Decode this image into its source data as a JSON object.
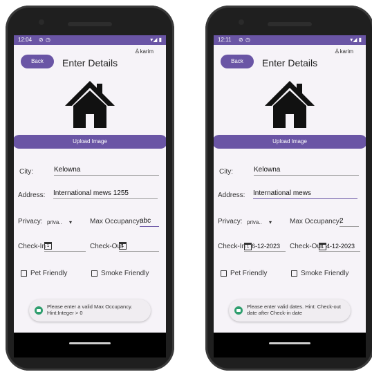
{
  "screens": [
    {
      "status_time": "12:04",
      "user": "karim",
      "back_label": "Back",
      "title": "Enter Details",
      "upload_label": "Upload Image",
      "city_label": "City:",
      "city_value": "Kelowna",
      "address_label": "Address:",
      "address_value": "International mews 1255",
      "privacy_label": "Privacy:",
      "privacy_value": "priva..",
      "max_occupancy_label": "Max Occupancy:",
      "max_occupancy_value": "abc",
      "checkin_label": "Check-In",
      "checkin_value": "",
      "checkout_label": "Check-Out",
      "checkout_value": "",
      "pet_label": "Pet Friendly",
      "smoke_label": "Smoke Friendly",
      "toast": "Please enter a valid Max Occupancy. Hint:Integer > 0"
    },
    {
      "status_time": "12:11",
      "user": "karim",
      "back_label": "Back",
      "title": "Enter Details",
      "upload_label": "Upload Image",
      "city_label": "City:",
      "city_value": "Kelowna",
      "address_label": "Address:",
      "address_value": "International mews",
      "privacy_label": "Privacy:",
      "privacy_value": "priva..",
      "max_occupancy_label": "Max Occupancy:",
      "max_occupancy_value": "2",
      "checkin_label": "Check-In",
      "checkin_value": "6-12-2023",
      "checkout_label": "Check-Out",
      "checkout_value": "4-12-2023",
      "pet_label": "Pet Friendly",
      "smoke_label": "Smoke Friendly",
      "toast": "Please enter valid dates. Hint: Check-out date after Check-in date"
    }
  ],
  "colors": {
    "accent": "#6a55a5",
    "toast_icon": "#2f9e6e"
  },
  "icons": [
    "house-icon",
    "calendar-icon",
    "user-icon",
    "dropdown-arrow-icon",
    "wifi-icon",
    "battery-icon"
  ]
}
